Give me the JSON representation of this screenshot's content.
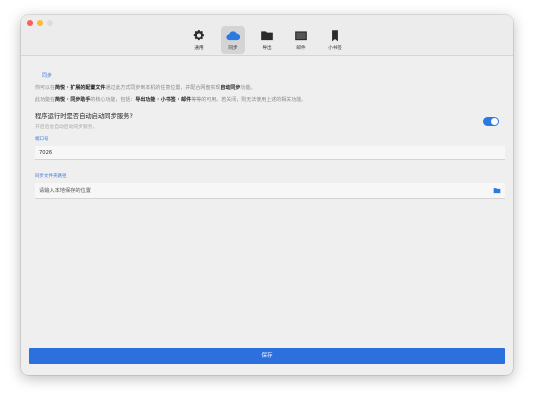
{
  "tabs": [
    {
      "label": "通用",
      "icon": "gear-icon"
    },
    {
      "label": "同步",
      "icon": "cloud-icon"
    },
    {
      "label": "导出",
      "icon": "folder-icon"
    },
    {
      "label": "邮件",
      "icon": "mail-icon"
    },
    {
      "label": "小书签",
      "icon": "bookmark-icon"
    }
  ],
  "active_tab": "同步",
  "sync": {
    "section_title": "同步",
    "desc1": {
      "p1": "你可以在",
      "b1": "简悦 · 扩展的配置文件",
      "p2": "通过此方式同步到本机的任意位置，并配合网盘实现",
      "b2": "自动同步",
      "p3": "功能。"
    },
    "desc2": {
      "p1": "此功能在",
      "b1": "简悦 · 同步助手",
      "p2": "的核心功能，包括：",
      "b2": "导出功能 · 小书签 · 邮件",
      "p3": "等等的可用。若关闭，则无法使用上述的相关功能。"
    },
    "autostart_question": "程序运行时是否自动启动同步服务?",
    "autostart_hint": "开启后会自动启动同步服务。",
    "autostart_enabled": true,
    "port_label": "端口号",
    "port_value": "7026",
    "folder_label": "同步文件夹路径",
    "folder_placeholder": "请输入本地保存的位置"
  },
  "save_label": "保存",
  "colors": {
    "accent": "#2c6fde",
    "toggle": "#2a7ae2",
    "close": "#fe5f57",
    "minimize": "#febc2e"
  }
}
